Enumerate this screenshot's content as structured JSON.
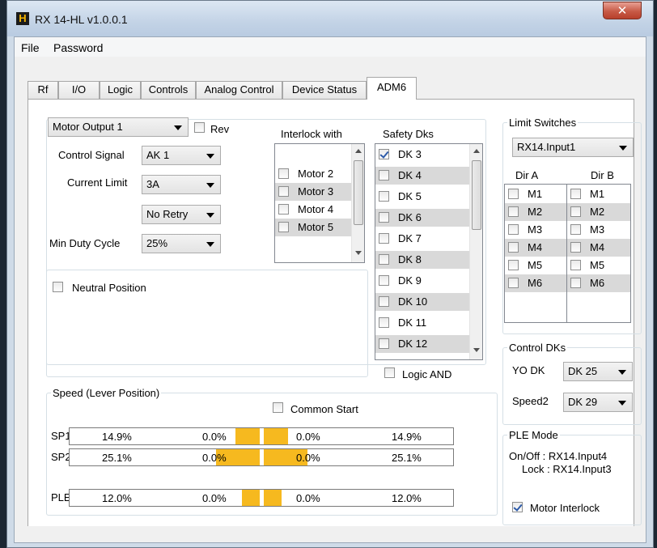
{
  "window": {
    "title": "RX 14-HL v1.0.0.1",
    "icon_letter": "H",
    "close_glyph": "✕"
  },
  "menu": [
    "File",
    "Password"
  ],
  "tabs": [
    {
      "label": "Rf",
      "active": false
    },
    {
      "label": "I/O",
      "active": false
    },
    {
      "label": "Logic",
      "active": false
    },
    {
      "label": "Controls",
      "active": false
    },
    {
      "label": "Analog Control",
      "active": false
    },
    {
      "label": "Device Status",
      "active": false
    },
    {
      "label": "ADM6",
      "active": true
    }
  ],
  "motor": {
    "selector": "Motor Output 1",
    "rev_label": "Rev",
    "rev_checked": false,
    "control_signal_label": "Control Signal",
    "control_signal": "AK 1",
    "current_limit_label": "Current Limit",
    "current_limit": "3A",
    "retry": "No Retry",
    "min_duty_label": "Min Duty Cycle",
    "min_duty": "25%",
    "neutral_label": "Neutral Position",
    "neutral_checked": false
  },
  "interlock": {
    "title": "Interlock with",
    "items": [
      "Motor 2",
      "Motor 3",
      "Motor 4",
      "Motor 5"
    ]
  },
  "safety": {
    "title": "Safety Dks",
    "items": [
      {
        "label": "DK 3",
        "checked": true
      },
      {
        "label": "DK 4",
        "checked": false
      },
      {
        "label": "DK 5",
        "checked": false
      },
      {
        "label": "DK 6",
        "checked": false
      },
      {
        "label": "DK 7",
        "checked": false
      },
      {
        "label": "DK 8",
        "checked": false
      },
      {
        "label": "DK 9",
        "checked": false
      },
      {
        "label": "DK 10",
        "checked": false
      },
      {
        "label": "DK 11",
        "checked": false
      },
      {
        "label": "DK 12",
        "checked": false
      }
    ],
    "logic_and_label": "Logic AND",
    "logic_and_checked": false
  },
  "speed": {
    "title": "Speed (Lever Position)",
    "common_start_label": "Common Start",
    "common_start_checked": false,
    "rows": [
      {
        "label": "SP1",
        "v1": "14.9%",
        "v2": "0.0%",
        "v3": "0.0%",
        "v4": "14.9%"
      },
      {
        "label": "SP2",
        "v1": "25.1%",
        "v2": "0.0%",
        "v3": "0.0%",
        "v4": "25.1%"
      },
      {
        "label": "PLE",
        "v1": "12.0%",
        "v2": "0.0%",
        "v3": "0.0%",
        "v4": "12.0%"
      }
    ]
  },
  "limit_switches": {
    "title": "Limit Switches",
    "input": "RX14.Input1",
    "dir_a": "Dir A",
    "dir_b": "Dir B",
    "a_items": [
      "M1",
      "M2",
      "M3",
      "M4",
      "M5",
      "M6"
    ],
    "b_items": [
      "M1",
      "M2",
      "M3",
      "M4",
      "M5",
      "M6"
    ]
  },
  "control_dks": {
    "title": "Control DKs",
    "yo_label": "YO DK",
    "yo_value": "DK 25",
    "speed2_label": "Speed2",
    "speed2_value": "DK 29"
  },
  "ple_mode": {
    "title": "PLE Mode",
    "onoff": "On/Off : RX14.Input4",
    "lock": "Lock : RX14.Input3",
    "motor_interlock_label": "Motor Interlock",
    "motor_interlock_checked": true
  },
  "colors": {
    "speed_fill": "#f6b91f",
    "selected_check": "#2c5aa8"
  }
}
